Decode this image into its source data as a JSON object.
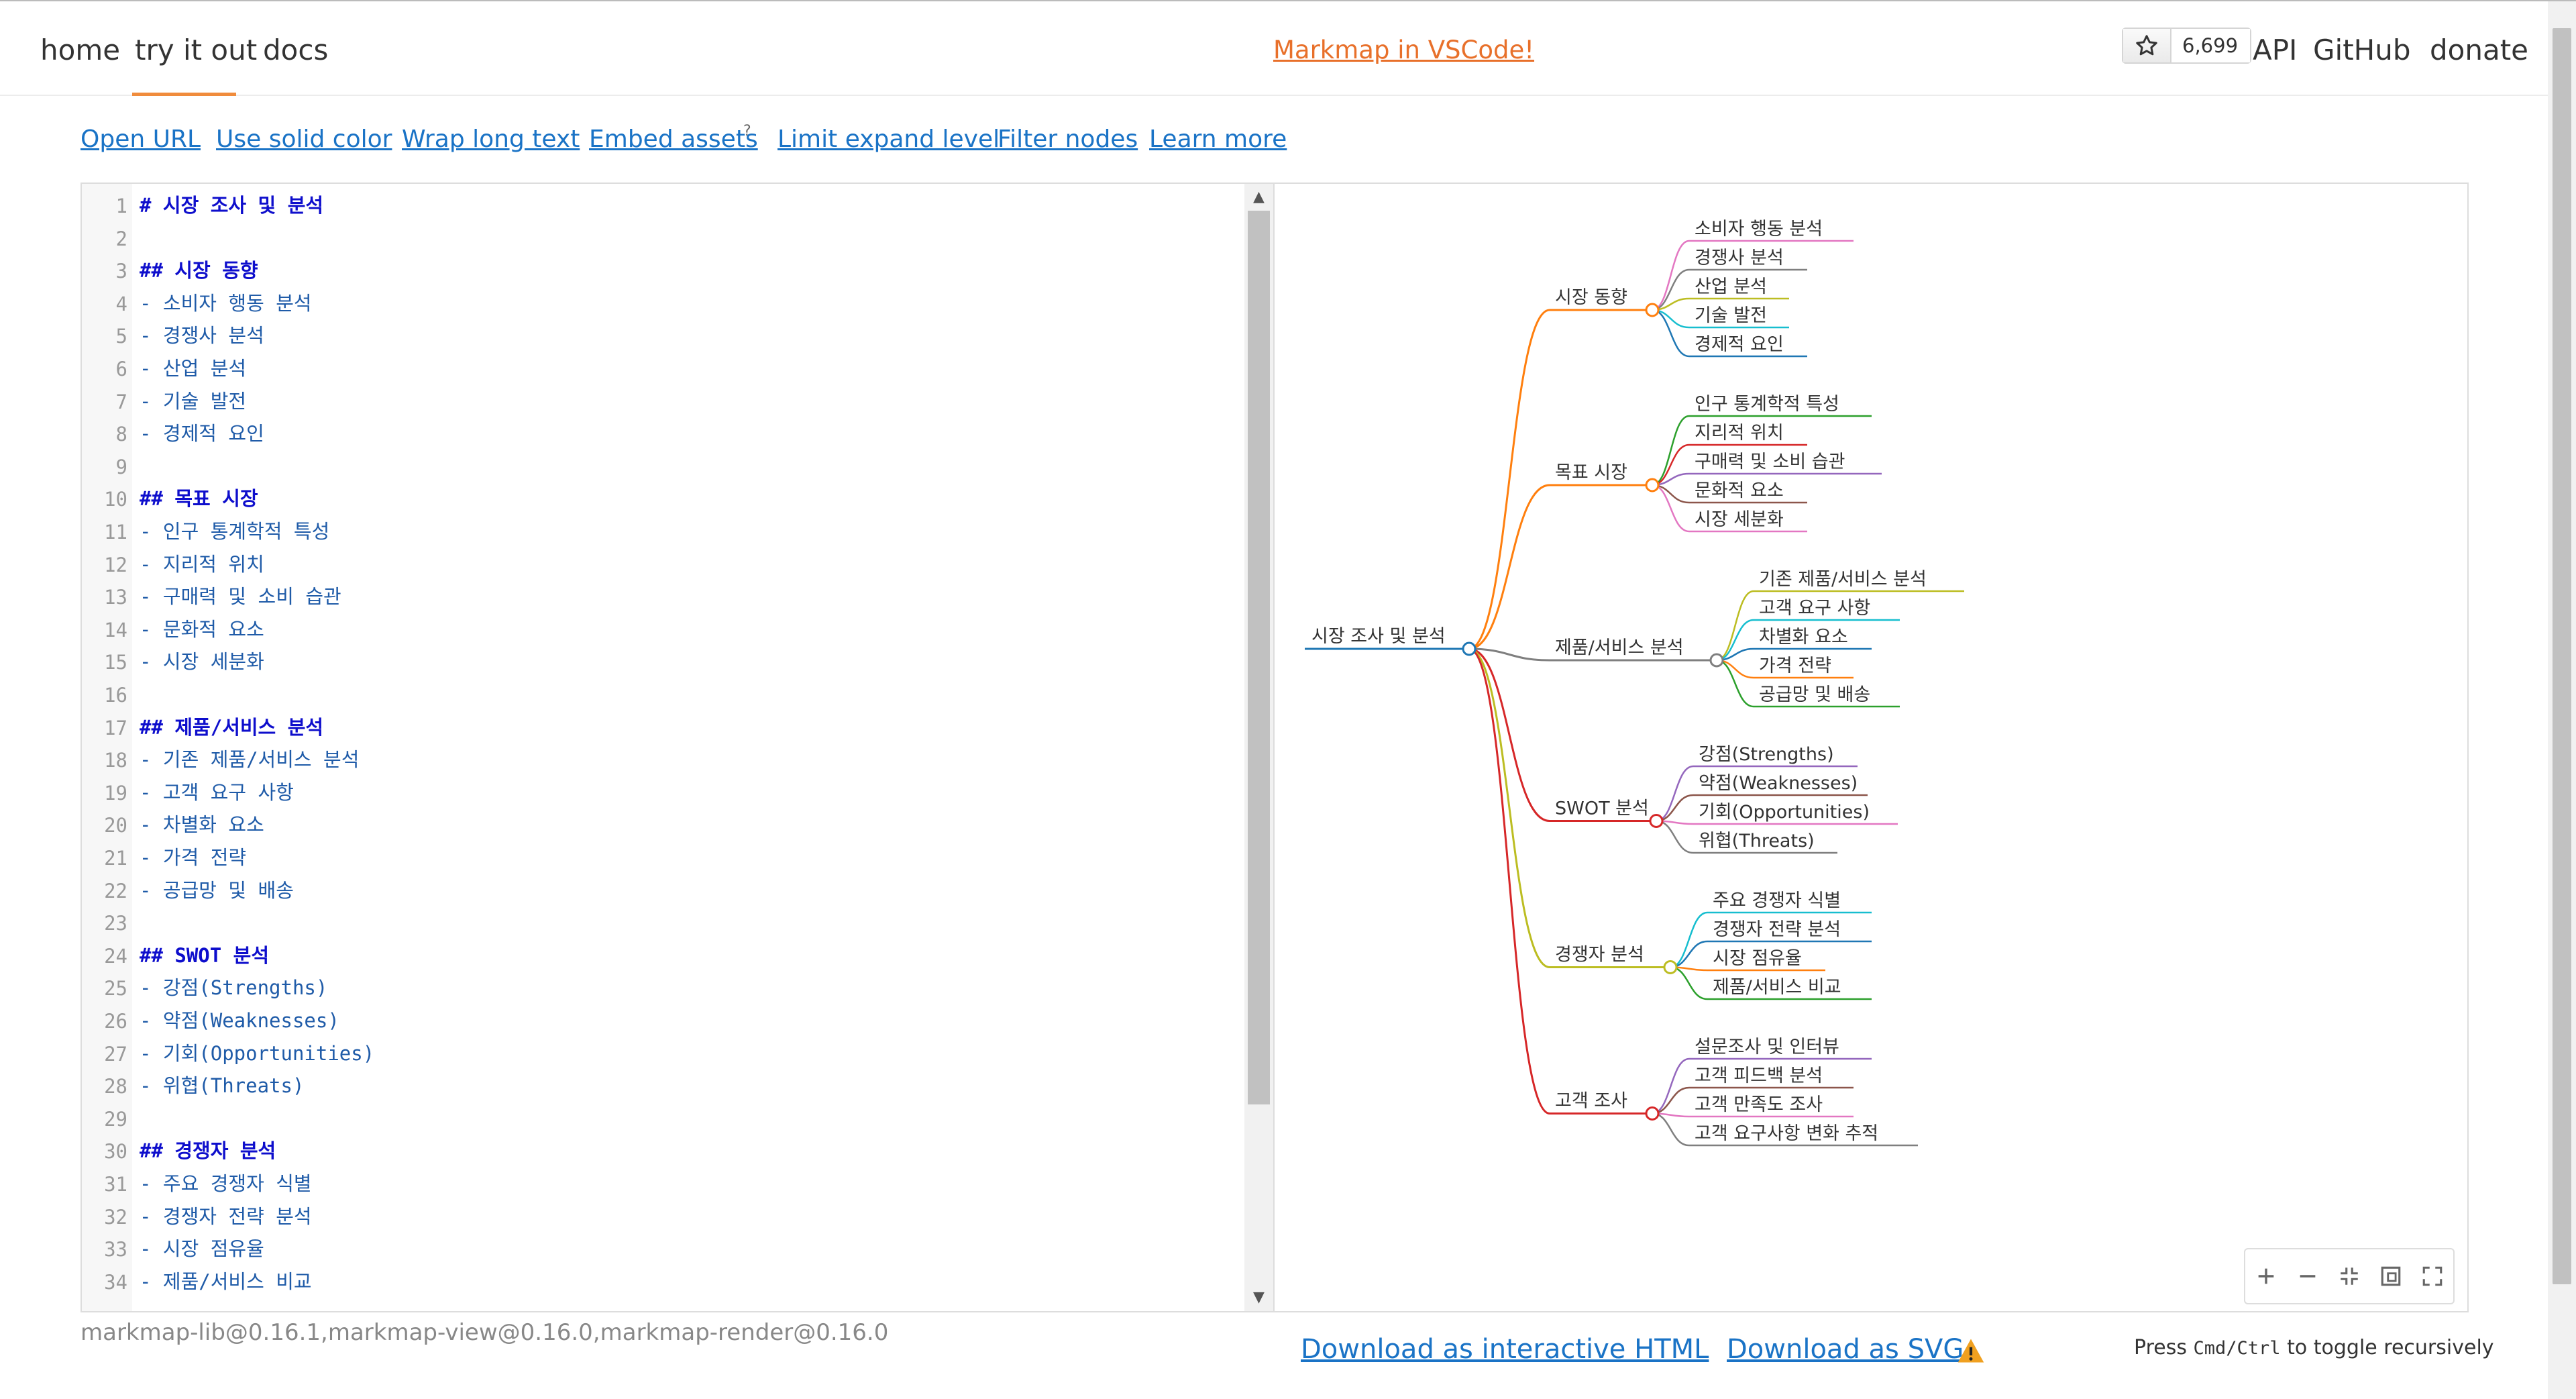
{
  "nav": {
    "home": "home",
    "try": "try it out",
    "docs": "docs",
    "promo": "Markmap in VSCode!",
    "star_count": "6,699",
    "api": "API",
    "github": "GitHub",
    "donate": "donate"
  },
  "toolbar": {
    "open_url": "Open URL",
    "solid_color": "Use solid color",
    "wrap_text": "Wrap long text",
    "embed_assets": "Embed assets",
    "embed_sup": "?",
    "limit_expand": "Limit expand level",
    "filter_nodes": "Filter nodes",
    "learn_more": "Learn more"
  },
  "editor": {
    "lines": [
      {
        "n": "1",
        "text": "# 시장 조사 및 분석",
        "kind": "h"
      },
      {
        "n": "2",
        "text": "",
        "kind": "li"
      },
      {
        "n": "3",
        "text": "## 시장 동향",
        "kind": "h"
      },
      {
        "n": "4",
        "text": "- 소비자 행동 분석",
        "kind": "li"
      },
      {
        "n": "5",
        "text": "- 경쟁사 분석",
        "kind": "li"
      },
      {
        "n": "6",
        "text": "- 산업 분석",
        "kind": "li"
      },
      {
        "n": "7",
        "text": "- 기술 발전",
        "kind": "li"
      },
      {
        "n": "8",
        "text": "- 경제적 요인",
        "kind": "li"
      },
      {
        "n": "9",
        "text": "",
        "kind": "li"
      },
      {
        "n": "10",
        "text": "## 목표 시장",
        "kind": "h"
      },
      {
        "n": "11",
        "text": "- 인구 통계학적 특성",
        "kind": "li"
      },
      {
        "n": "12",
        "text": "- 지리적 위치",
        "kind": "li"
      },
      {
        "n": "13",
        "text": "- 구매력 및 소비 습관",
        "kind": "li"
      },
      {
        "n": "14",
        "text": "- 문화적 요소",
        "kind": "li"
      },
      {
        "n": "15",
        "text": "- 시장 세분화",
        "kind": "li"
      },
      {
        "n": "16",
        "text": "",
        "kind": "li"
      },
      {
        "n": "17",
        "text": "## 제품/서비스 분석",
        "kind": "h"
      },
      {
        "n": "18",
        "text": "- 기존 제품/서비스 분석",
        "kind": "li"
      },
      {
        "n": "19",
        "text": "- 고객 요구 사항",
        "kind": "li"
      },
      {
        "n": "20",
        "text": "- 차별화 요소",
        "kind": "li"
      },
      {
        "n": "21",
        "text": "- 가격 전략",
        "kind": "li"
      },
      {
        "n": "22",
        "text": "- 공급망 및 배송",
        "kind": "li"
      },
      {
        "n": "23",
        "text": "",
        "kind": "li"
      },
      {
        "n": "24",
        "text": "## SWOT 분석",
        "kind": "h"
      },
      {
        "n": "25",
        "text": "- 강점(Strengths)",
        "kind": "li"
      },
      {
        "n": "26",
        "text": "- 약점(Weaknesses)",
        "kind": "li"
      },
      {
        "n": "27",
        "text": "- 기회(Opportunities)",
        "kind": "li"
      },
      {
        "n": "28",
        "text": "- 위협(Threats)",
        "kind": "li"
      },
      {
        "n": "29",
        "text": "",
        "kind": "li"
      },
      {
        "n": "30",
        "text": "## 경쟁자 분석",
        "kind": "h"
      },
      {
        "n": "31",
        "text": "- 주요 경쟁자 식별",
        "kind": "li"
      },
      {
        "n": "32",
        "text": "- 경쟁자 전략 분석",
        "kind": "li"
      },
      {
        "n": "33",
        "text": "- 시장 점유율",
        "kind": "li"
      },
      {
        "n": "34",
        "text": "- 제품/서비스 비교",
        "kind": "li"
      }
    ]
  },
  "mindmap": {
    "root": "시장 조사 및 분석",
    "root_color": "#1f77b4",
    "branches": [
      {
        "label": "시장 동향",
        "color": "#ff7f0e",
        "children": [
          {
            "label": "소비자 행동 분석",
            "color": "#e377c2"
          },
          {
            "label": "경쟁사 분석",
            "color": "#7f7f7f"
          },
          {
            "label": "산업 분석",
            "color": "#bcbd22"
          },
          {
            "label": "기술 발전",
            "color": "#17becf"
          },
          {
            "label": "경제적 요인",
            "color": "#1f77b4"
          }
        ]
      },
      {
        "label": "목표 시장",
        "color": "#ff7f0e",
        "children": [
          {
            "label": "인구 통계학적 특성",
            "color": "#2ca02c"
          },
          {
            "label": "지리적 위치",
            "color": "#d62728"
          },
          {
            "label": "구매력 및 소비 습관",
            "color": "#9467bd"
          },
          {
            "label": "문화적 요소",
            "color": "#8c564b"
          },
          {
            "label": "시장 세분화",
            "color": "#e377c2"
          }
        ]
      },
      {
        "label": "제품/서비스 분석",
        "color": "#7f7f7f",
        "children": [
          {
            "label": "기존 제품/서비스 분석",
            "color": "#bcbd22"
          },
          {
            "label": "고객 요구 사항",
            "color": "#17becf"
          },
          {
            "label": "차별화 요소",
            "color": "#1f77b4"
          },
          {
            "label": "가격 전략",
            "color": "#ff7f0e"
          },
          {
            "label": "공급망 및 배송",
            "color": "#2ca02c"
          }
        ]
      },
      {
        "label": "SWOT 분석",
        "color": "#d62728",
        "children": [
          {
            "label": "강점(Strengths)",
            "color": "#9467bd"
          },
          {
            "label": "약점(Weaknesses)",
            "color": "#8c564b"
          },
          {
            "label": "기회(Opportunities)",
            "color": "#e377c2"
          },
          {
            "label": "위협(Threats)",
            "color": "#7f7f7f"
          }
        ]
      },
      {
        "label": "경쟁자 분석",
        "color": "#bcbd22",
        "children": [
          {
            "label": "주요 경쟁자 식별",
            "color": "#17becf"
          },
          {
            "label": "경쟁자 전략 분석",
            "color": "#1f77b4"
          },
          {
            "label": "시장 점유율",
            "color": "#ff7f0e"
          },
          {
            "label": "제품/서비스 비교",
            "color": "#2ca02c"
          }
        ]
      },
      {
        "label": "고객 조사",
        "color": "#d62728",
        "children": [
          {
            "label": "설문조사 및 인터뷰",
            "color": "#9467bd"
          },
          {
            "label": "고객 피드백 분석",
            "color": "#8c564b"
          },
          {
            "label": "고객 만족도 조사",
            "color": "#e377c2"
          },
          {
            "label": "고객 요구사항 변화 추적",
            "color": "#7f7f7f"
          }
        ]
      }
    ]
  },
  "zoom": {
    "zoom_in": "zoom-in-icon",
    "zoom_out": "zoom-out-icon",
    "fit": "fit-icon",
    "recurse": "toggle-recursive-icon",
    "fullscreen": "fullscreen-icon"
  },
  "footer": {
    "versions": "markmap-lib@0.16.1,markmap-view@0.16.0,markmap-render@0.16.0",
    "download_html": "Download as interactive HTML",
    "download_svg": "Download as SVG",
    "hint_press": "Press",
    "hint_key": "Cmd/Ctrl",
    "hint_rest": "to toggle recursively"
  }
}
